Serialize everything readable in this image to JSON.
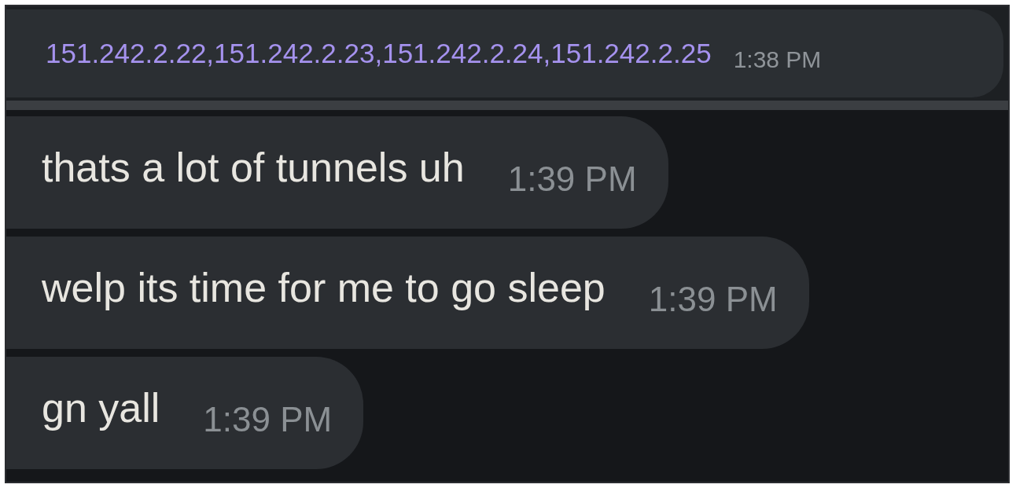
{
  "pinned_message": {
    "text": "151.242.2.22,151.242.2.23,151.242.2.24,151.242.2.25",
    "time": "1:38 PM"
  },
  "messages": [
    {
      "text": "thats a lot of tunnels uh",
      "time": "1:39 PM"
    },
    {
      "text": "welp its time for me to go sleep",
      "time": "1:39 PM"
    },
    {
      "text": "gn yall",
      "time": "1:39 PM"
    }
  ]
}
